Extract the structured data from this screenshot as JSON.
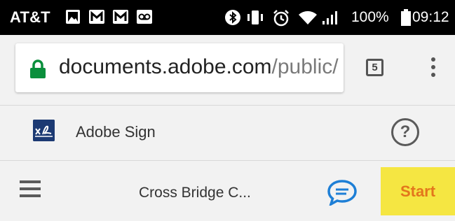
{
  "status_bar": {
    "carrier": "AT&T",
    "battery_percent": "100%",
    "time": "09:12",
    "notification_icons": [
      "gallery-icon",
      "gmail-icon",
      "gmail-icon",
      "voicemail-icon"
    ],
    "system_icons": [
      "bluetooth-icon",
      "vibrate-icon",
      "alarm-icon",
      "wifi-icon",
      "signal-icon",
      "battery-icon"
    ]
  },
  "browser": {
    "url_host": "documents.adobe.com",
    "url_path": "/public/",
    "tab_count": "5"
  },
  "app_header": {
    "brand": "Adobe Sign"
  },
  "toolbar": {
    "document_title": "Cross Bridge C...",
    "start_label": "Start"
  },
  "colors": {
    "lock_green": "#0a8f3c",
    "logo_blue": "#1c3a73",
    "chat_blue": "#1e7fd6",
    "start_bg": "#f5e642",
    "start_text": "#e3761c"
  }
}
